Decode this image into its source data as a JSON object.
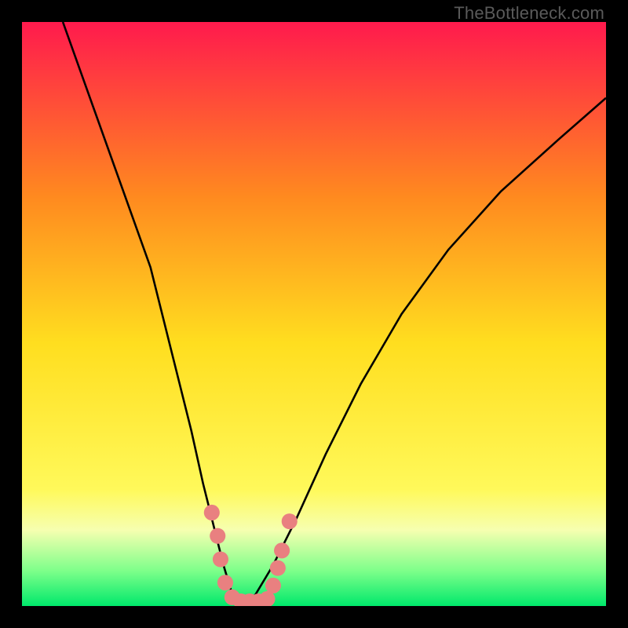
{
  "watermark": "TheBottleneck.com",
  "chart_data": {
    "type": "line",
    "title": "",
    "xlabel": "",
    "ylabel": "",
    "xlim": [
      0,
      100
    ],
    "ylim": [
      0,
      100
    ],
    "background_gradient": [
      {
        "y": 100,
        "color": "#ff1a4d"
      },
      {
        "y": 70,
        "color": "#ff8a1f"
      },
      {
        "y": 45,
        "color": "#ffde1f"
      },
      {
        "y": 20,
        "color": "#fff95a"
      },
      {
        "y": 13,
        "color": "#f6ffb0"
      },
      {
        "y": 6,
        "color": "#7dff8a"
      },
      {
        "y": 0,
        "color": "#00e86b"
      }
    ],
    "series": [
      {
        "name": "bottleneck-curve",
        "color": "#000000",
        "x": [
          7,
          12,
          17,
          22,
          26,
          29,
          31,
          33,
          34.5,
          36,
          37,
          38,
          40,
          43,
          47,
          52,
          58,
          65,
          73,
          82,
          92,
          100
        ],
        "y": [
          100,
          86,
          72,
          58,
          42,
          30,
          21,
          13,
          7,
          2,
          0,
          0,
          2,
          7,
          15,
          26,
          38,
          50,
          61,
          71,
          80,
          87
        ]
      }
    ],
    "markers": {
      "name": "bottleneck-markers",
      "color": "#e98080",
      "radius_pct": 1.35,
      "points": [
        {
          "x": 32.5,
          "y": 16
        },
        {
          "x": 33.5,
          "y": 12
        },
        {
          "x": 34.0,
          "y": 8
        },
        {
          "x": 34.8,
          "y": 4
        },
        {
          "x": 36.0,
          "y": 1.5
        },
        {
          "x": 37.5,
          "y": 0.8
        },
        {
          "x": 39.0,
          "y": 0.8
        },
        {
          "x": 40.5,
          "y": 0.8
        },
        {
          "x": 42.0,
          "y": 1.2
        },
        {
          "x": 43.0,
          "y": 3.5
        },
        {
          "x": 43.8,
          "y": 6.5
        },
        {
          "x": 44.5,
          "y": 9.5
        },
        {
          "x": 45.8,
          "y": 14.5
        }
      ]
    }
  }
}
